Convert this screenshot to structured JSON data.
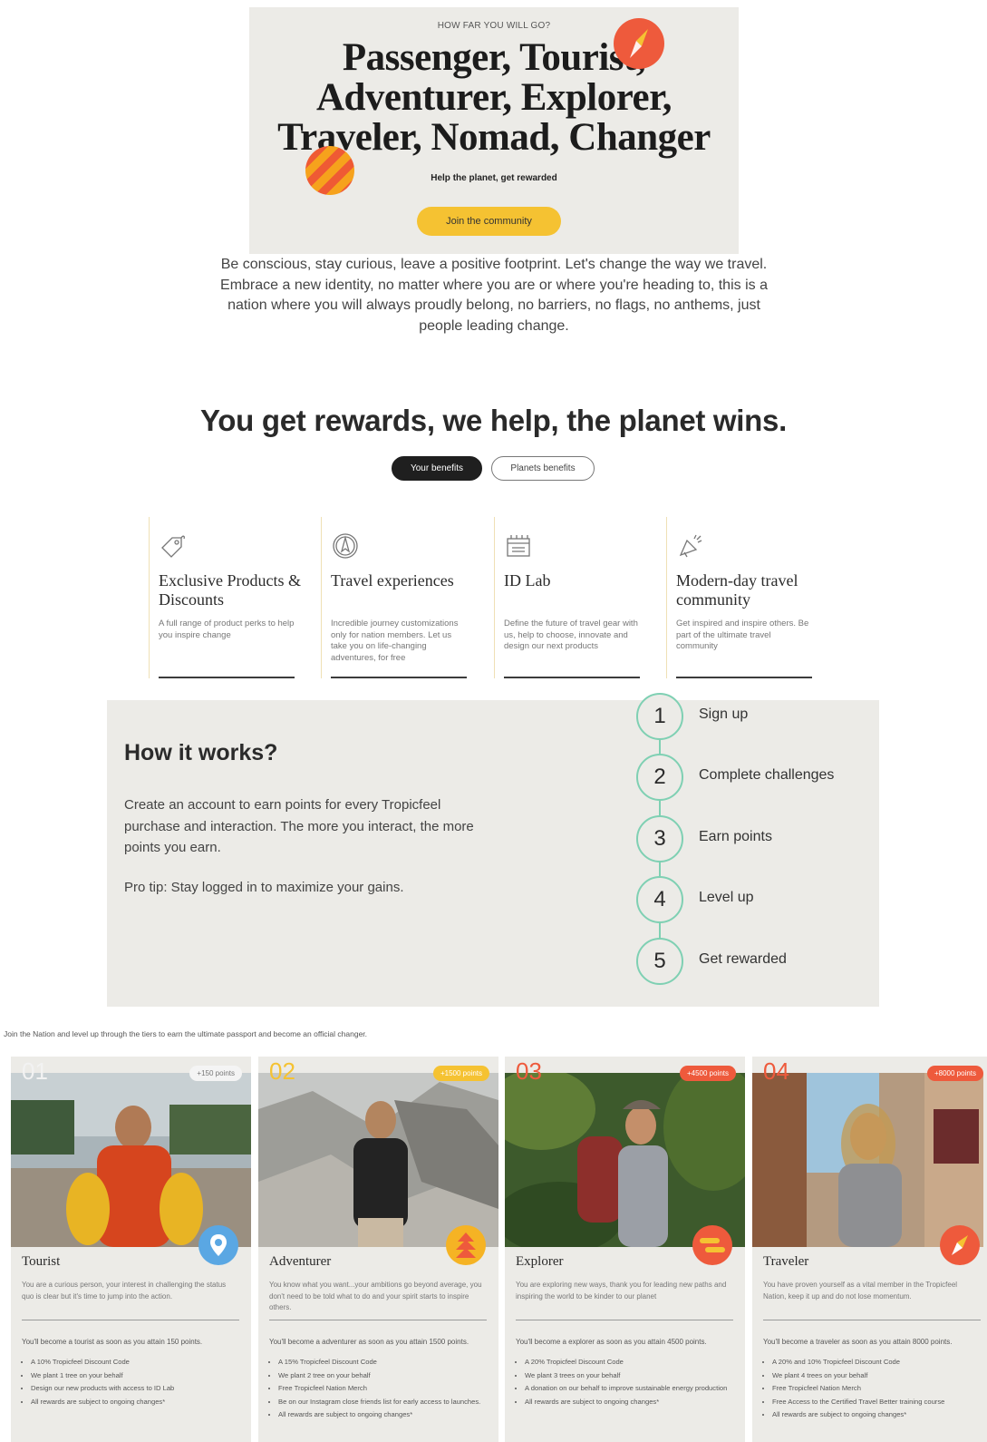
{
  "hero": {
    "eyebrow": "HOW FAR YOU WILL GO?",
    "title_line1": "Passenger, Tourist,",
    "title_line2": "Adventurer, Explorer,",
    "title_line3": "Traveler, Nomad, Changer",
    "subtitle": "Help the planet, get rewarded",
    "cta": "Join the community"
  },
  "intro": {
    "line1": "Be conscious, stay curious, leave a positive footprint. Let's change the way we travel.",
    "line2": "Embrace a new identity, no matter where you are or where you're heading to, this is a",
    "line3": "nation where you will always proudly belong, no barriers, no flags, no anthems, just",
    "line4": "people leading change."
  },
  "rewards": {
    "title": "You get rewards, we help, the planet wins.",
    "tabs": [
      "Your benefits",
      "Planets benefits"
    ],
    "benefits": [
      {
        "icon": "tag-icon",
        "title": "Exclusive Products & Discounts",
        "desc": "A full range of product perks to help you inspire change"
      },
      {
        "icon": "compass-icon",
        "title": "Travel experiences",
        "desc": "Incredible journey customizations only for nation members. Let us take you on life-changing adventures, for free"
      },
      {
        "icon": "lab-icon",
        "title": "ID Lab",
        "desc": "Define the future of travel gear with us, help to choose, innovate and design our next products"
      },
      {
        "icon": "megaphone-icon",
        "title": "Modern-day travel community",
        "desc": "Get inspired and inspire others. Be part of the ultimate travel community"
      }
    ]
  },
  "how": {
    "title": "How it works?",
    "text": "Create an account to earn points for every Tropicfeel purchase and interaction. The more you interact, the more points you earn.",
    "tip": "Pro tip: Stay logged in to maximize your gains.",
    "steps": [
      {
        "num": "1",
        "label": "Sign up"
      },
      {
        "num": "2",
        "label": "Complete challenges"
      },
      {
        "num": "3",
        "label": "Earn points"
      },
      {
        "num": "4",
        "label": "Level up"
      },
      {
        "num": "5",
        "label": "Get rewarded"
      }
    ]
  },
  "tiers": {
    "intro": "Join the Nation and level up through the tiers to earn the ultimate passport and become an official changer.",
    "items": [
      {
        "num": "01",
        "points": "+150 points",
        "name": "Tourist",
        "badge_icon": "map-pin-icon",
        "desc": "You are a curious person, your interest in challenging the status quo is clear but it's time to jump into the action.",
        "attain": "You'll become a tourist as soon as you attain 150 points.",
        "perks": [
          "A 10% Tropicfeel Discount Code",
          "We plant 1 tree on your behalf",
          "Design our new products with access to ID Lab",
          "All rewards are subject to ongoing changes*"
        ]
      },
      {
        "num": "02",
        "points": "+1500 points",
        "name": "Adventurer",
        "badge_icon": "triangles-icon",
        "desc": "You know what you want...your ambitions go beyond average, you don't need to be told what to do and your spirit starts to inspire others.",
        "attain": "You'll become a adventurer as soon as you attain 1500 points.",
        "perks": [
          "A 15% Tropicfeel Discount Code",
          "We plant 2 tree on your behalf",
          "Free Tropicfeel Nation Merch",
          "Be on our Instagram close friends list for early access to launches.",
          "All rewards are subject to ongoing changes*"
        ]
      },
      {
        "num": "03",
        "points": "+4500 points",
        "name": "Explorer",
        "badge_icon": "stripes-icon",
        "desc": "You are exploring new ways, thank you for leading new paths and inspiring the world to be kinder to our planet",
        "attain": "You'll become a explorer as soon as you attain 4500 points.",
        "perks": [
          "A 20% Tropicfeel Discount Code",
          "We plant 3 trees on your behalf",
          "A donation on our behalf to improve sustainable energy production",
          "All rewards are subject to ongoing changes*"
        ]
      },
      {
        "num": "04",
        "points": "+8000 points",
        "name": "Traveler",
        "badge_icon": "compass-icon",
        "desc": "You have proven yourself as a vital member in the Tropicfeel Nation, keep it up and do not lose momentum.",
        "attain": "You'll become a traveler as soon as you attain 8000 points.",
        "perks": [
          "A 20% and 10% Tropicfeel Discount Code",
          "We plant 4 trees on your behalf",
          "Free Tropicfeel Nation Merch",
          "Free Access to the Certified Travel Better training course",
          "All rewards are subject to ongoing changes*"
        ]
      }
    ]
  },
  "colors": {
    "accent_yellow": "#f5c232",
    "accent_orange": "#ee5a3c",
    "teal": "#7fd0b3",
    "blue_badge": "#5aa7e3"
  }
}
